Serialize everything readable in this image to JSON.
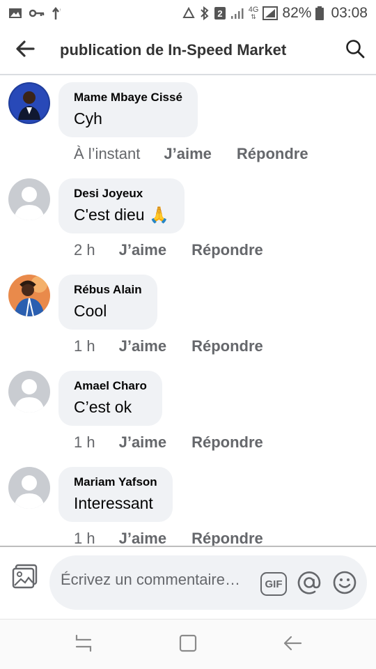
{
  "status_bar": {
    "battery": "82%",
    "time": "03:08",
    "network": "4G",
    "sim_badge": "2"
  },
  "header": {
    "title": "publication de In-Speed Market"
  },
  "comments": [
    {
      "author": "Mame Mbaye Cissé",
      "text": "Cyh",
      "time": "À l’instant",
      "like": "J’aime",
      "reply": "Répondre",
      "avatar": "photo"
    },
    {
      "author": "Desi Joyeux",
      "text": "C'est dieu 🙏",
      "time": "2 h",
      "like": "J’aime",
      "reply": "Répondre",
      "avatar": "default"
    },
    {
      "author": "Rébus Alain",
      "text": "Cool",
      "time": "1 h",
      "like": "J’aime",
      "reply": "Répondre",
      "avatar": "photo"
    },
    {
      "author": "Amael Charo",
      "text": "C’est ok",
      "time": "1 h",
      "like": "J’aime",
      "reply": "Répondre",
      "avatar": "default"
    },
    {
      "author": "Mariam Yafson",
      "text": "Interessant",
      "time": "1 h",
      "like": "J’aime",
      "reply": "Répondre",
      "avatar": "default"
    }
  ],
  "composer": {
    "placeholder": "Écrivez un commentaire…",
    "gif_label": "GIF"
  },
  "colors": {
    "bubble": "#f0f2f5",
    "meta": "#65676b",
    "text": "#050505"
  }
}
